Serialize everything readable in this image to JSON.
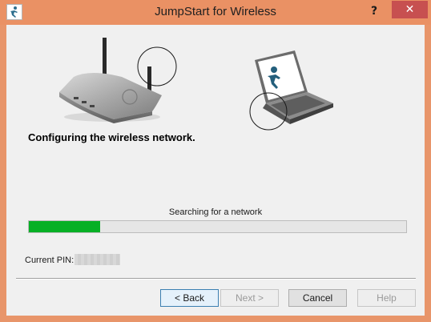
{
  "window": {
    "title": "JumpStart for Wireless",
    "help_glyph": "?",
    "close_glyph": "✕"
  },
  "main": {
    "heading": "Configuring the wireless network.",
    "status_text": "Searching for a network",
    "progress": 0.19,
    "pin_label": "Current PIN:"
  },
  "buttons": {
    "back": "< Back",
    "next": "Next >",
    "cancel": "Cancel",
    "help": "Help"
  },
  "colors": {
    "titlebar": "#ea9164",
    "close_button": "#c75050",
    "progress_fill": "#06b025"
  },
  "icons": {
    "app": "jumpstart-app-icon",
    "router": "router-icon",
    "laptop": "laptop-icon"
  }
}
